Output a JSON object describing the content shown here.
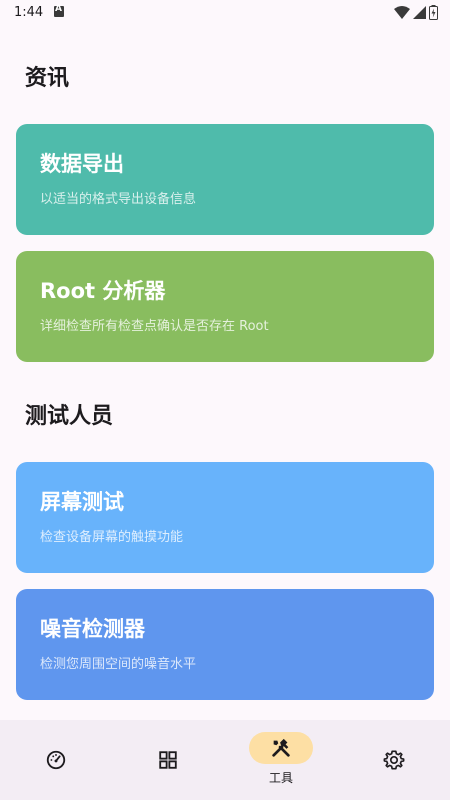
{
  "status_bar": {
    "time": "1:44"
  },
  "sections": [
    {
      "title": "资讯",
      "cards": [
        {
          "title": "数据导出",
          "description": "以适当的格式导出设备信息",
          "color": "#4fbbab"
        },
        {
          "title": "Root 分析器",
          "description": "详细检查所有检查点确认是否存在 Root",
          "color": "#89bd5f"
        }
      ]
    },
    {
      "title": "测试人员",
      "cards": [
        {
          "title": "屏幕测试",
          "description": "检查设备屏幕的触摸功能",
          "color": "#68b3fb"
        },
        {
          "title": "噪音检测器",
          "description": "检测您周围空间的噪音水平",
          "color": "#5f96ee"
        }
      ]
    }
  ],
  "bottom_nav": {
    "items": [
      {
        "icon": "speedometer-icon",
        "label": ""
      },
      {
        "icon": "grid-icon",
        "label": ""
      },
      {
        "icon": "tools-icon",
        "label": "工具",
        "selected": true
      },
      {
        "icon": "gear-icon",
        "label": ""
      }
    ]
  }
}
